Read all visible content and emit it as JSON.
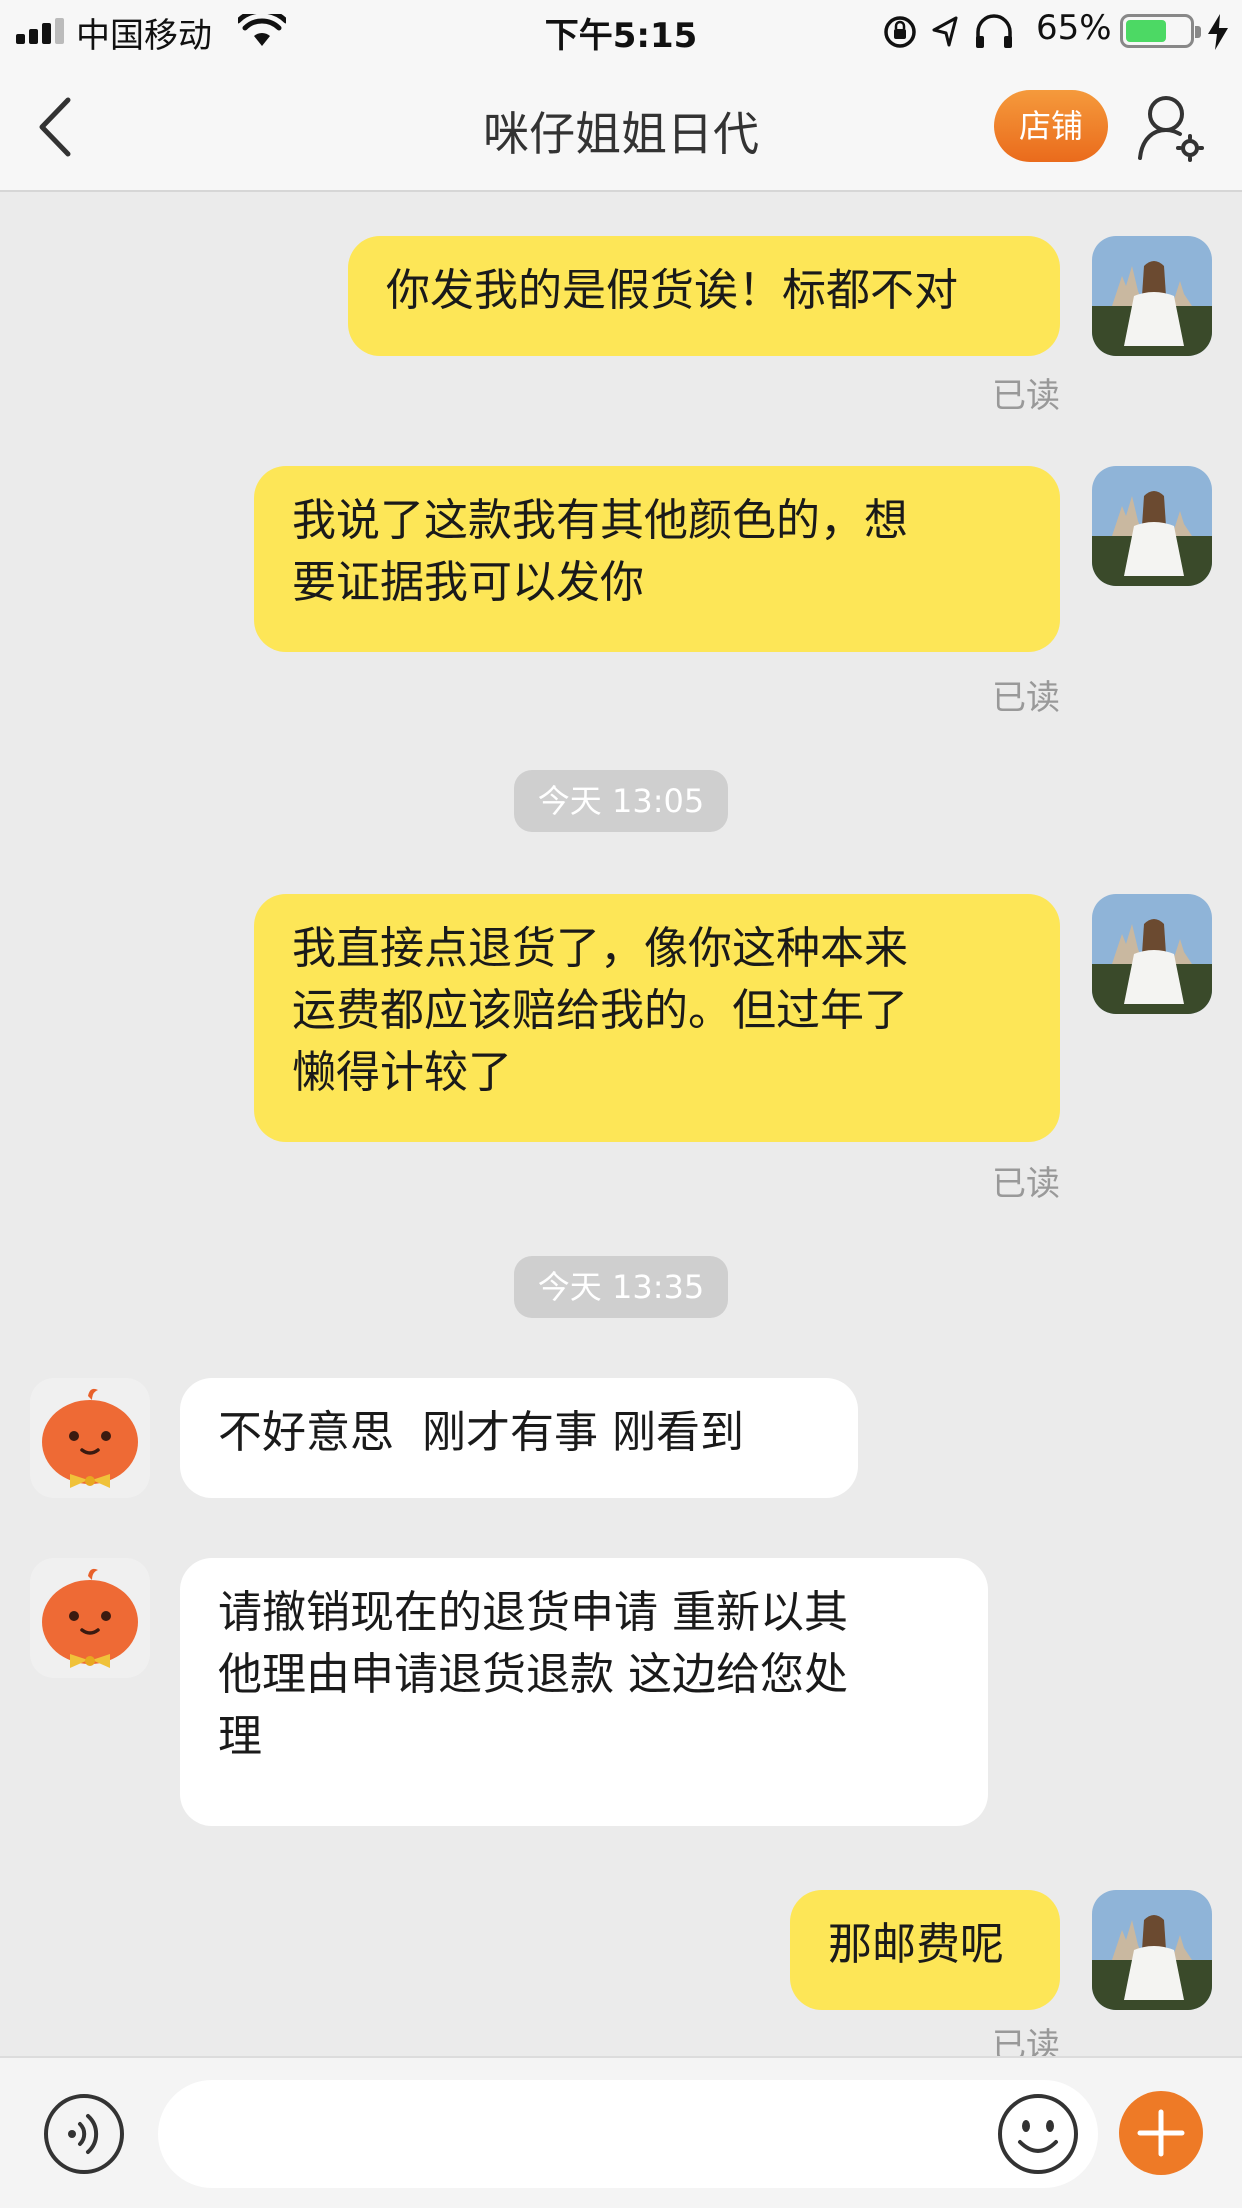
{
  "status_bar": {
    "carrier": "中国移动",
    "time": "下午5:15",
    "battery_pct": "65%",
    "battery_level": 0.65,
    "icons": [
      "signal-icon",
      "wifi-icon",
      "rotation-lock-icon",
      "location-icon",
      "headphones-icon",
      "battery-icon",
      "charging-icon"
    ]
  },
  "nav": {
    "title": "咪仔姐姐日代",
    "shop_label": "店铺",
    "shop_color": "#ee7a26",
    "icons": [
      "back-icon",
      "user-settings-icon"
    ]
  },
  "messages": [
    {
      "from": "me",
      "text": "你发我的是假货诶！标都不对",
      "status": "已读"
    },
    {
      "from": "me",
      "text": "我说了这款我有其他颜色的，想\n要证据我可以发你",
      "status": "已读"
    },
    {
      "type": "time",
      "text": "今天 13:05"
    },
    {
      "from": "me",
      "text": "我直接点退货了，像你这种本来\n运费都应该赔给我的。但过年了\n懒得计较了",
      "status": "已读"
    },
    {
      "type": "time",
      "text": "今天 13:35"
    },
    {
      "from": "other",
      "text": "不好意思  刚才有事 刚看到"
    },
    {
      "from": "other",
      "text": "请撤销现在的退货申请 重新以其\n他理由申请退货退款 这边给您处\n理"
    },
    {
      "from": "me",
      "text": "那邮费呢",
      "status": "已读"
    }
  ],
  "colors": {
    "my_bubble": "#fde657",
    "other_bubble": "#ffffff",
    "background": "#ebebeb",
    "accent": "#ee7a26"
  },
  "input_bar": {
    "placeholder": "",
    "icons": [
      "voice-icon",
      "emoji-icon",
      "plus-icon"
    ]
  }
}
